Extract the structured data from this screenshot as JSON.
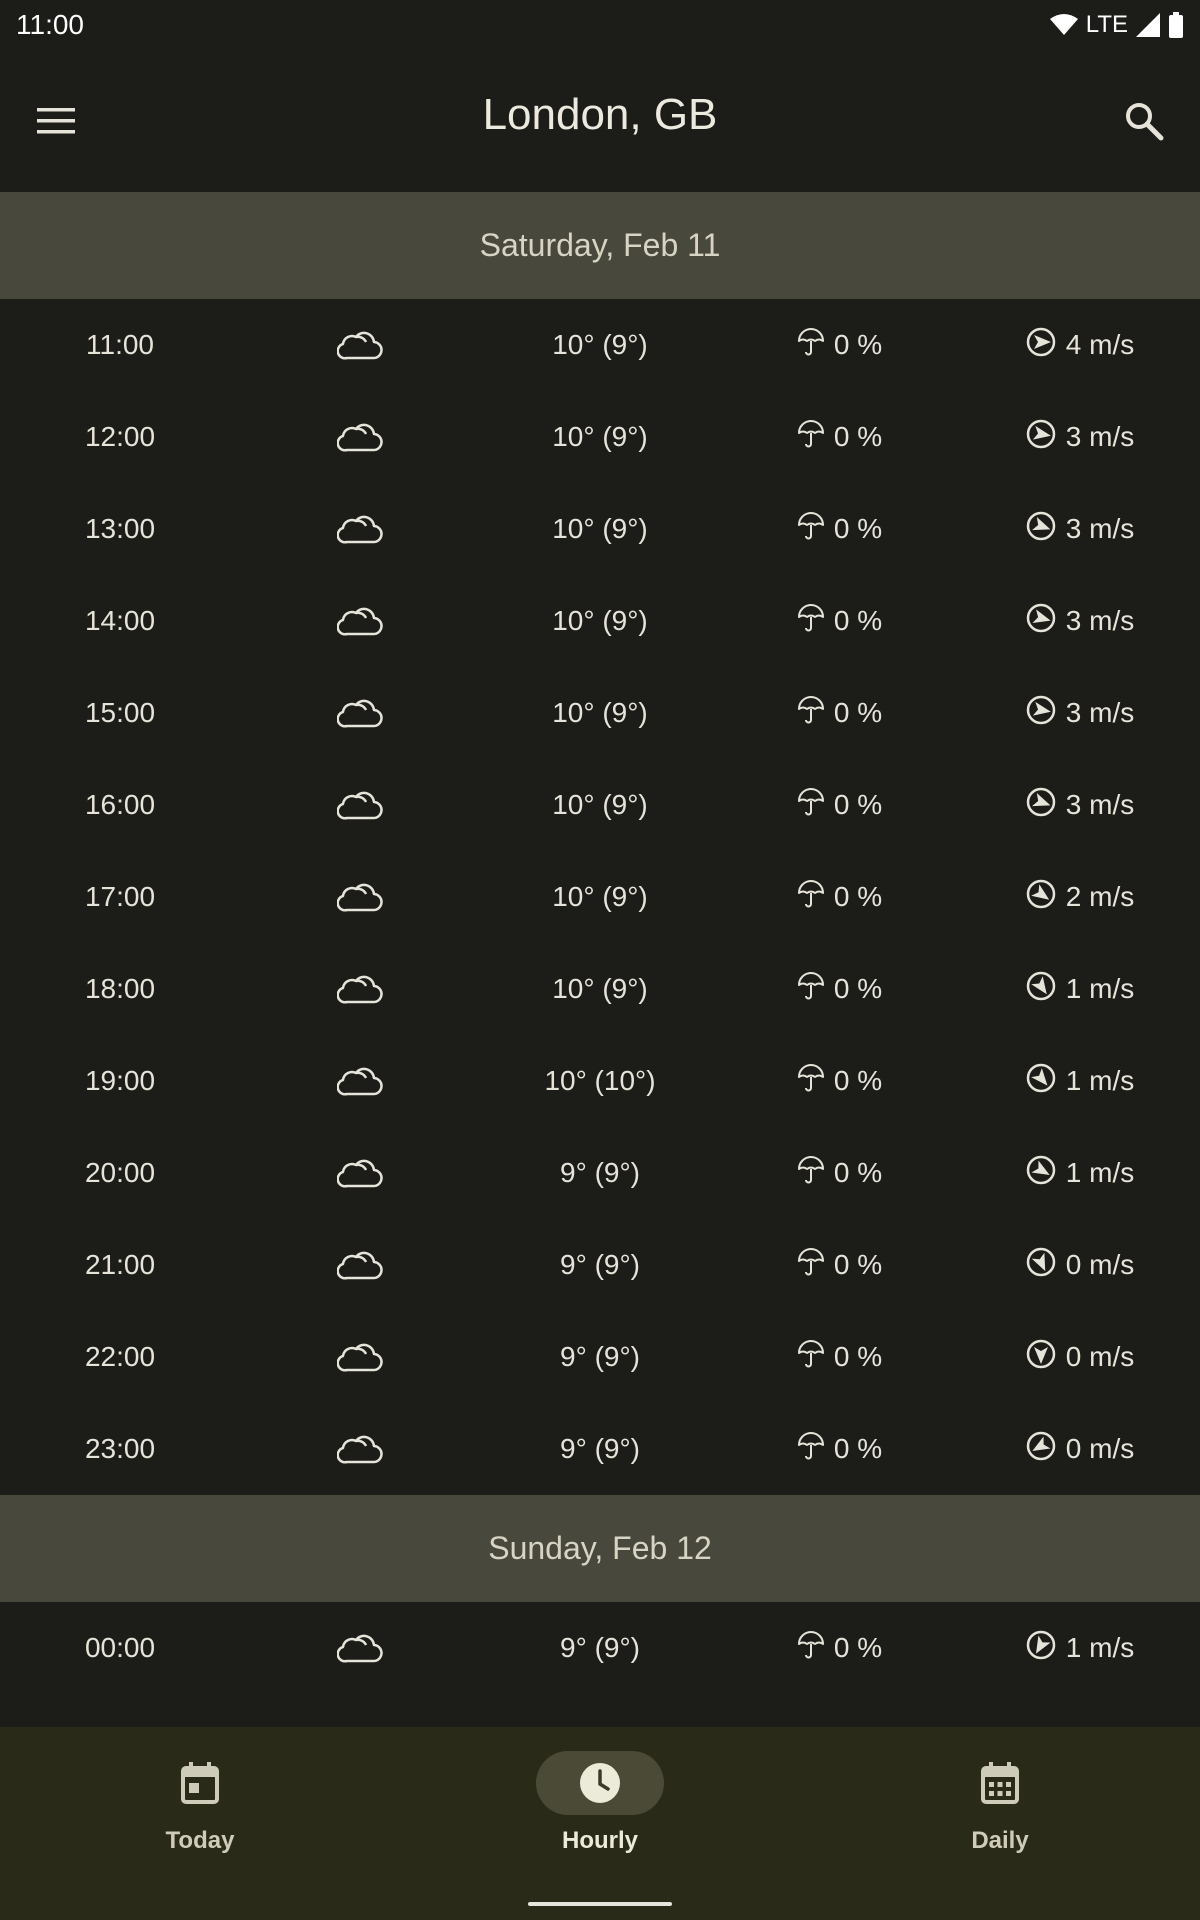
{
  "status_bar": {
    "time": "11:00",
    "network": "LTE"
  },
  "app_bar": {
    "title": "London, GB"
  },
  "days": [
    {
      "header": "Saturday, Feb 11",
      "rows": [
        {
          "time": "11:00",
          "temp": "10° (9°)",
          "precip": "0 %",
          "wind": "4 m/s",
          "wind_dir": 90
        },
        {
          "time": "12:00",
          "temp": "10° (9°)",
          "precip": "0 %",
          "wind": "3 m/s",
          "wind_dir": 100
        },
        {
          "time": "13:00",
          "temp": "10° (9°)",
          "precip": "0 %",
          "wind": "3 m/s",
          "wind_dir": 110
        },
        {
          "time": "14:00",
          "temp": "10° (9°)",
          "precip": "0 %",
          "wind": "3 m/s",
          "wind_dir": 105
        },
        {
          "time": "15:00",
          "temp": "10° (9°)",
          "precip": "0 %",
          "wind": "3 m/s",
          "wind_dir": 100
        },
        {
          "time": "16:00",
          "temp": "10° (9°)",
          "precip": "0 %",
          "wind": "3 m/s",
          "wind_dir": 110
        },
        {
          "time": "17:00",
          "temp": "10° (9°)",
          "precip": "0 %",
          "wind": "2 m/s",
          "wind_dir": 125
        },
        {
          "time": "18:00",
          "temp": "10° (9°)",
          "precip": "0 %",
          "wind": "1 m/s",
          "wind_dir": 145
        },
        {
          "time": "19:00",
          "temp": "10° (10°)",
          "precip": "0 %",
          "wind": "1 m/s",
          "wind_dir": 140
        },
        {
          "time": "20:00",
          "temp": "9° (9°)",
          "precip": "0 %",
          "wind": "1 m/s",
          "wind_dir": 120
        },
        {
          "time": "21:00",
          "temp": "9° (9°)",
          "precip": "0 %",
          "wind": "0 m/s",
          "wind_dir": 155
        },
        {
          "time": "22:00",
          "temp": "9° (9°)",
          "precip": "0 %",
          "wind": "0 m/s",
          "wind_dir": 180
        },
        {
          "time": "23:00",
          "temp": "9° (9°)",
          "precip": "0 %",
          "wind": "0 m/s",
          "wind_dir": 240
        }
      ]
    },
    {
      "header": "Sunday, Feb 12",
      "rows": [
        {
          "time": "00:00",
          "temp": "9° (9°)",
          "precip": "0 %",
          "wind": "1 m/s",
          "wind_dir": 210
        }
      ]
    }
  ],
  "icons": {
    "weather": "cloud-icon",
    "precip": "umbrella-icon",
    "wind": "wind-direction-icon"
  },
  "bottom_nav": {
    "items": [
      {
        "label": "Today",
        "icon": "calendar-today-icon"
      },
      {
        "label": "Hourly",
        "icon": "clock-icon"
      },
      {
        "label": "Daily",
        "icon": "calendar-month-icon"
      }
    ],
    "active": "Hourly"
  },
  "colors": {
    "background": "#1c1d19",
    "day_header": "#48483c",
    "bottom_nav": "#2a2a19",
    "active_pill": "#4a4a36"
  }
}
